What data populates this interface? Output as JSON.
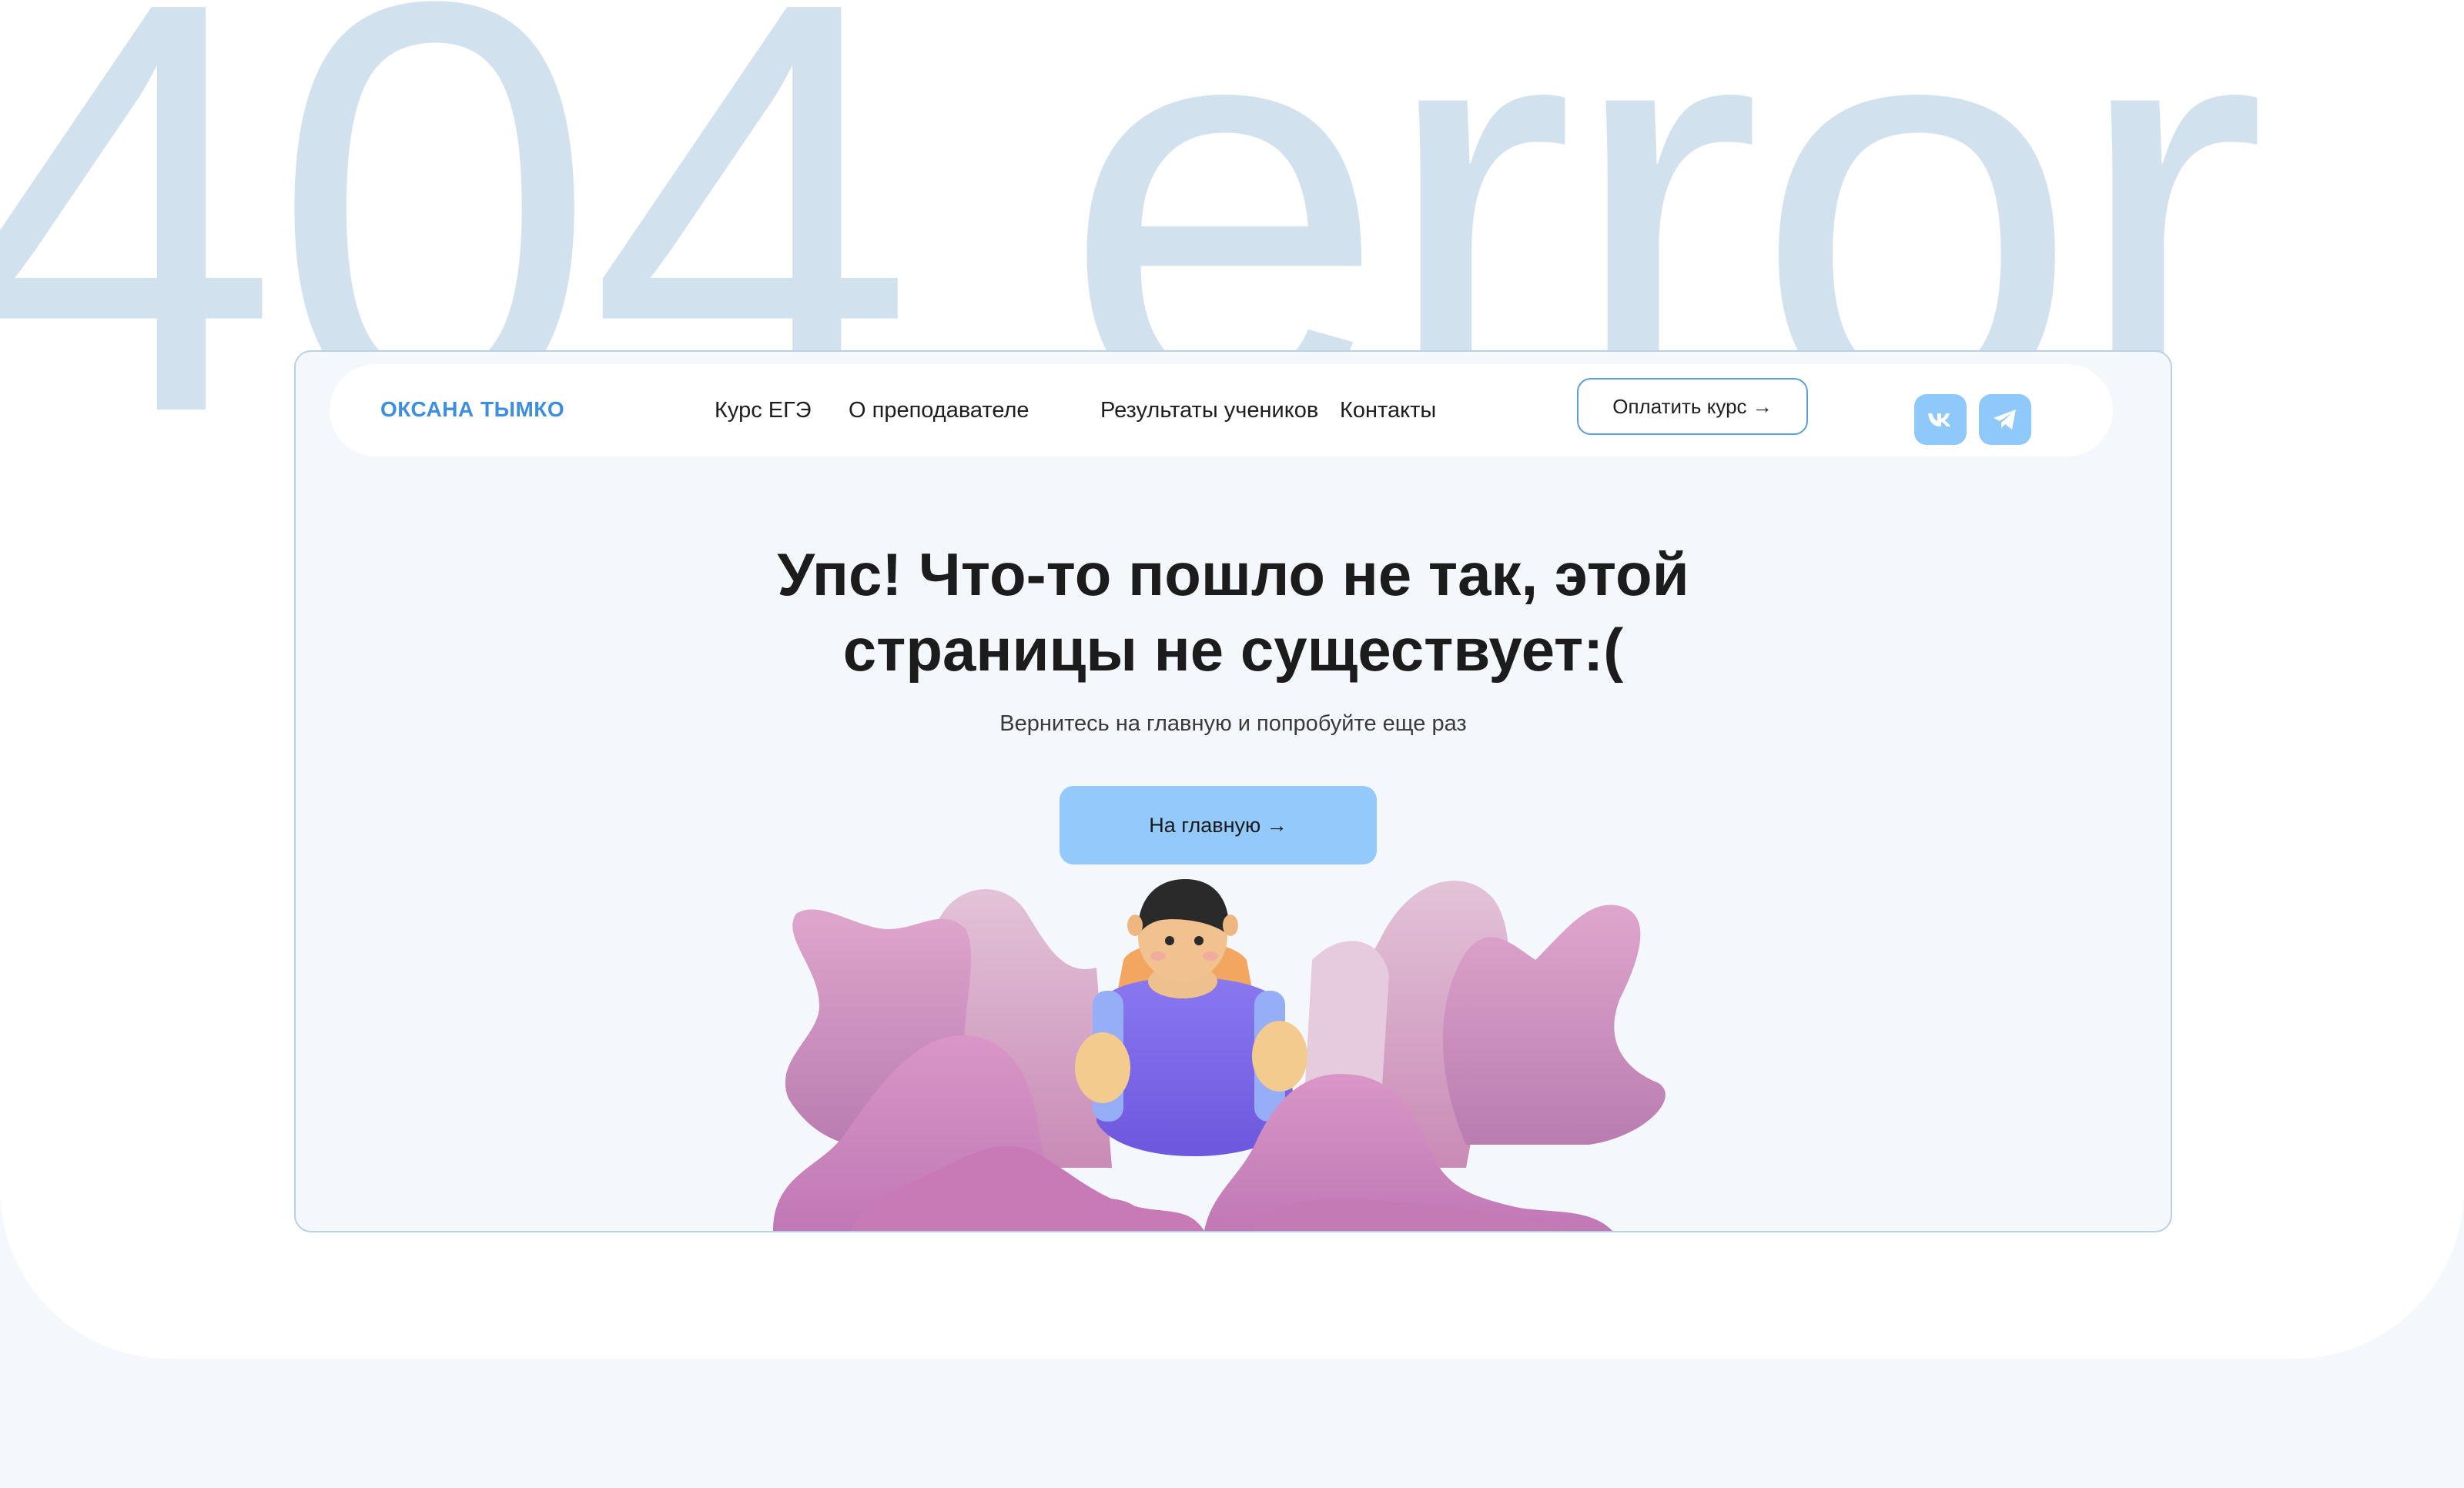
{
  "background": {
    "watermark_text": "404 error"
  },
  "header": {
    "brand": "ОКСАНА ТЫМКО",
    "nav": [
      {
        "label": "Курс ЕГЭ"
      },
      {
        "label": "О преподавателе"
      },
      {
        "label": "Результаты учеников"
      },
      {
        "label": "Контакты"
      }
    ],
    "pay_button": "Оплатить курс →",
    "social": [
      {
        "icon": "vk-icon"
      },
      {
        "icon": "telegram-icon"
      }
    ]
  },
  "main": {
    "title_line1": "Упс! Что-то пошло не так, этой",
    "title_line2": "страницы не существует:(",
    "subtitle": "Вернитесь на главную и попробуйте еще раз",
    "home_button": "На главную →"
  },
  "colors": {
    "accent": "#3e8ee0",
    "button_fill": "#93c9fb",
    "watermark": "#d2e1ee",
    "frame_border": "#b8d0e8",
    "blob_pink": "#d59ac4",
    "character_purple": "#7a66e6"
  }
}
